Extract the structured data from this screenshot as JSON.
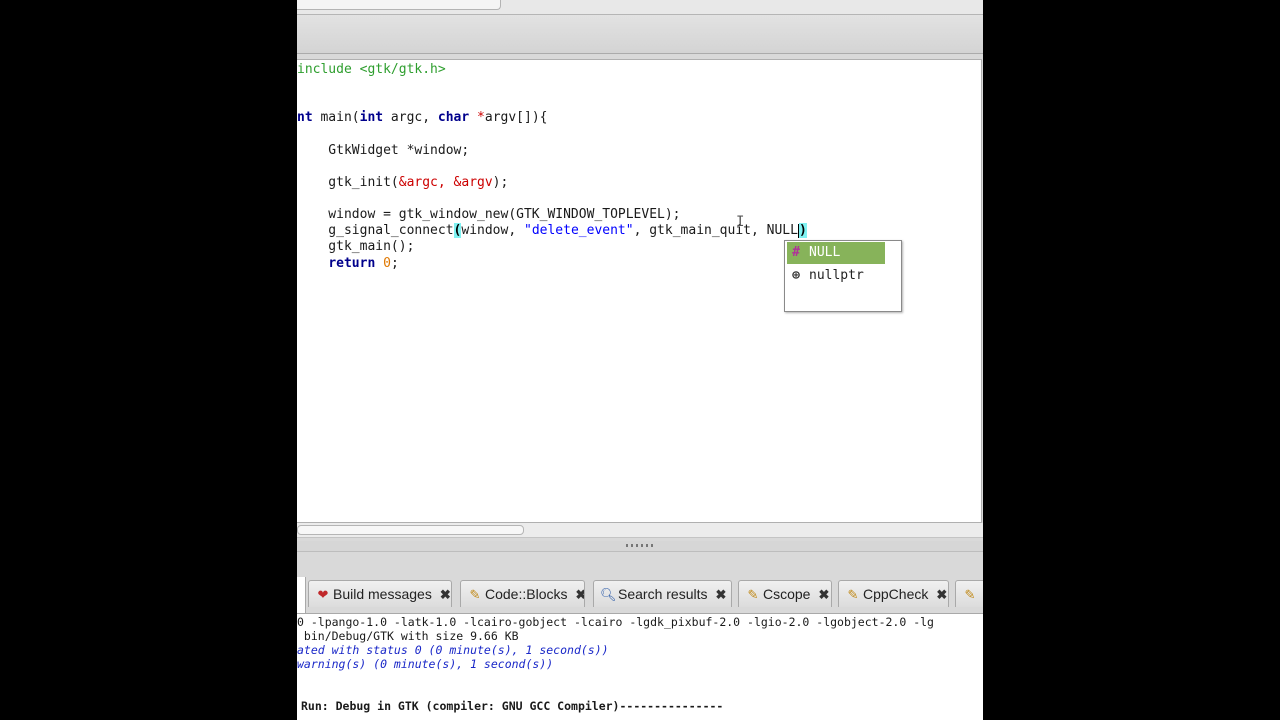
{
  "editor": {
    "lines": {
      "l1_pp": "include <gtk/gtk.h>",
      "l2_kw": "nt",
      "l2_a": " main(",
      "l2_kw2": "int",
      "l2_b": " argc, ",
      "l2_kw3": "char",
      "l2_c": " ",
      "l2_op": "*",
      "l2_d": "argv[]){",
      "l3": "    GtkWidget *window;",
      "l4_a": "    gtk_init(",
      "l4_b": "&argc, &argv",
      "l4_c": ");",
      "l5_a": "    window = gtk_window_new(GTK_WINDOW_TOPLEVEL);",
      "l6_a": "    g_signal_connect",
      "l6_paren": "(",
      "l6_b": "window, ",
      "l6_str": "\"delete_event\"",
      "l6_c": ", gtk_main_quit, NULL",
      "l6_close": ")",
      "l7": "    gtk_main();",
      "l8_kw": "return",
      "l8_num": "0",
      "l8_end": ";"
    }
  },
  "autocomplete": {
    "items": [
      {
        "icon": "#",
        "label": "NULL"
      },
      {
        "icon": "⊕",
        "label": "nullptr"
      }
    ]
  },
  "logs": {
    "tabs": [
      {
        "label": "Build messages",
        "icon": "build-messages-icon"
      },
      {
        "label": "Code::Blocks",
        "icon": "document-icon"
      },
      {
        "label": "Search results",
        "icon": "search-icon"
      },
      {
        "label": "Cscope",
        "icon": "document-icon"
      },
      {
        "label": "CppCheck",
        "icon": "document-icon"
      }
    ],
    "output": [
      "0 -lpango-1.0 -latk-1.0 -lcairo-gobject -lcairo -lgdk_pixbuf-2.0 -lgio-2.0 -lgobject-2.0 -lg",
      " bin/Debug/GTK with size 9.66 KB",
      "ated with status 0 (0 minute(s), 1 second(s))",
      "warning(s) (0 minute(s), 1 second(s))",
      "Run: Debug in GTK (compiler: GNU GCC Compiler)---------------"
    ]
  },
  "colors": {
    "autocomplete_selected": "#87b35a",
    "brace_highlight": "#7ff2f2",
    "log_blue": "#1a28c8"
  }
}
